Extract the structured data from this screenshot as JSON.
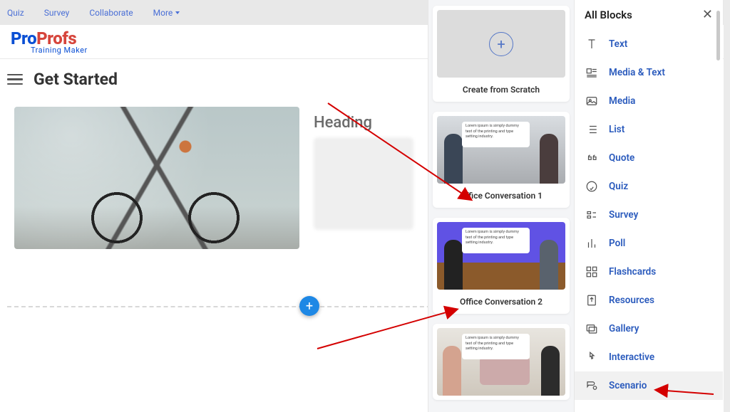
{
  "nav": {
    "quiz": "Quiz",
    "survey": "Survey",
    "collaborate": "Collaborate",
    "more": "More"
  },
  "logo": {
    "p1": "Pro",
    "p2": "Profs",
    "sub": "Training Maker"
  },
  "editor": {
    "title": "Get Started",
    "heading": "Heading"
  },
  "templates": {
    "scratch": "Create from Scratch",
    "conv1": "Office Conversation 1",
    "conv2": "Office Conversation 2",
    "lorem": "Lorem ipsum is simply dummy text of the printing and type setting industry."
  },
  "blocks": {
    "title": "All Blocks",
    "text": "Text",
    "mediaText": "Media & Text",
    "media": "Media",
    "list": "List",
    "quote": "Quote",
    "quiz": "Quiz",
    "survey": "Survey",
    "poll": "Poll",
    "flashcards": "Flashcards",
    "resources": "Resources",
    "gallery": "Gallery",
    "interactive": "Interactive",
    "scenario": "Scenario"
  }
}
